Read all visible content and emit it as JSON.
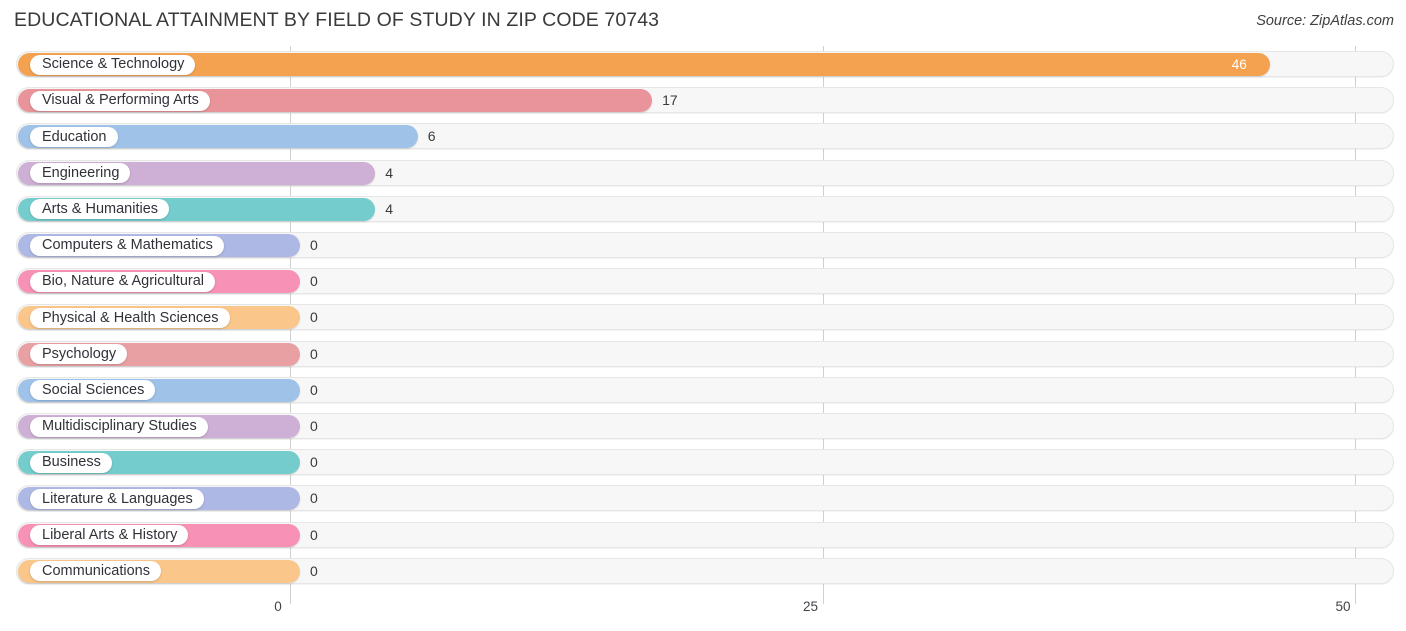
{
  "header": {
    "title": "EDUCATIONAL ATTAINMENT BY FIELD OF STUDY IN ZIP CODE 70743",
    "source": "Source: ZipAtlas.com"
  },
  "chart_data": {
    "type": "bar",
    "orientation": "horizontal",
    "title": "EDUCATIONAL ATTAINMENT BY FIELD OF STUDY IN ZIP CODE 70743",
    "xlabel": "",
    "ylabel": "",
    "xlim": [
      0,
      50
    ],
    "xticks": [
      0,
      25,
      50
    ],
    "xtick_labels": [
      "0",
      "25",
      "50"
    ],
    "grid": true,
    "legend": "none",
    "categories": [
      "Science & Technology",
      "Visual & Performing Arts",
      "Education",
      "Engineering",
      "Arts & Humanities",
      "Computers & Mathematics",
      "Bio, Nature & Agricultural",
      "Physical & Health Sciences",
      "Psychology",
      "Social Sciences",
      "Multidisciplinary Studies",
      "Business",
      "Literature & Languages",
      "Liberal Arts & History",
      "Communications"
    ],
    "values": [
      46,
      17,
      6,
      4,
      4,
      0,
      0,
      0,
      0,
      0,
      0,
      0,
      0,
      0,
      0
    ],
    "value_labels": [
      "46",
      "17",
      "6",
      "4",
      "4",
      "0",
      "0",
      "0",
      "0",
      "0",
      "0",
      "0",
      "0",
      "0",
      "0"
    ],
    "colors": [
      "#f5a250",
      "#e8949a",
      "#9fc2e9",
      "#ceafd5",
      "#74cccd",
      "#aeb8e5",
      "#f791b6",
      "#fbc68a",
      "#e9a0a3",
      "#9fc2e9",
      "#ceafd5",
      "#74cccd",
      "#aeb8e5",
      "#f791b6",
      "#fbc68a"
    ]
  }
}
